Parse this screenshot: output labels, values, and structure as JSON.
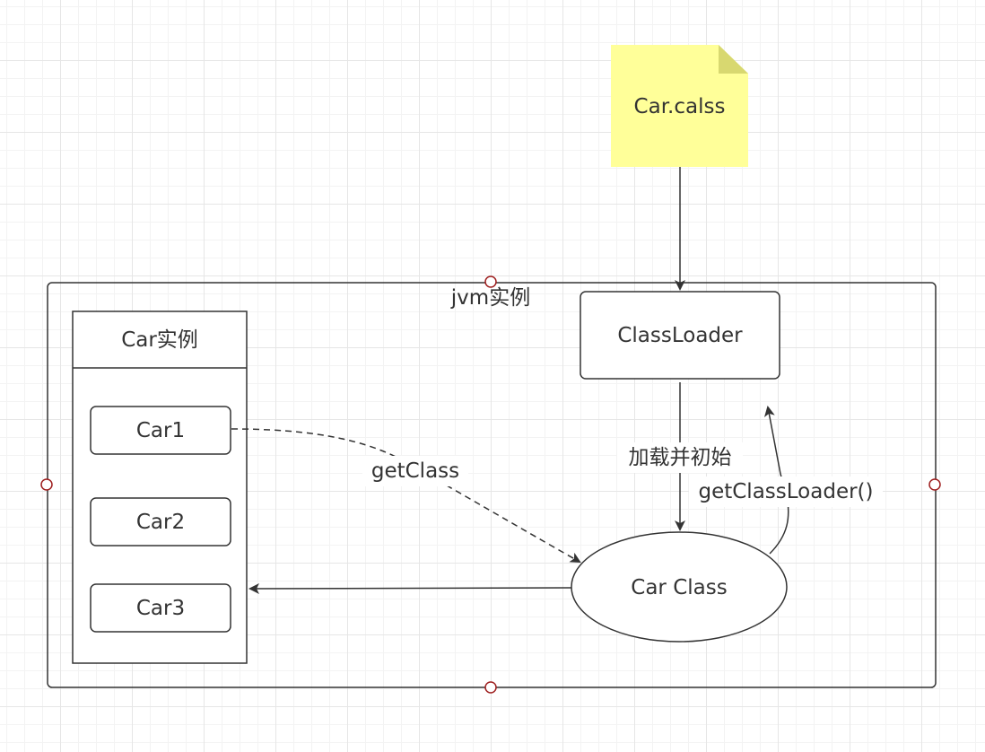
{
  "diagram": {
    "file_note": {
      "label": "Car.calss",
      "fill": "#ffff99",
      "fold": "#d8d870"
    },
    "jvm_container": {
      "label": "jvm实例"
    },
    "car_instances": {
      "header": "Car实例",
      "items": [
        "Car1",
        "Car2",
        "Car3"
      ]
    },
    "class_loader": {
      "label": "ClassLoader"
    },
    "car_class": {
      "label": "Car Class"
    },
    "edges": {
      "load_init": "加载并初始",
      "get_class": "getClass",
      "get_class_loader": "getClassLoader()"
    },
    "colors": {
      "stroke": "#333333",
      "handle": "#9e1e1e",
      "text": "#333333"
    }
  }
}
